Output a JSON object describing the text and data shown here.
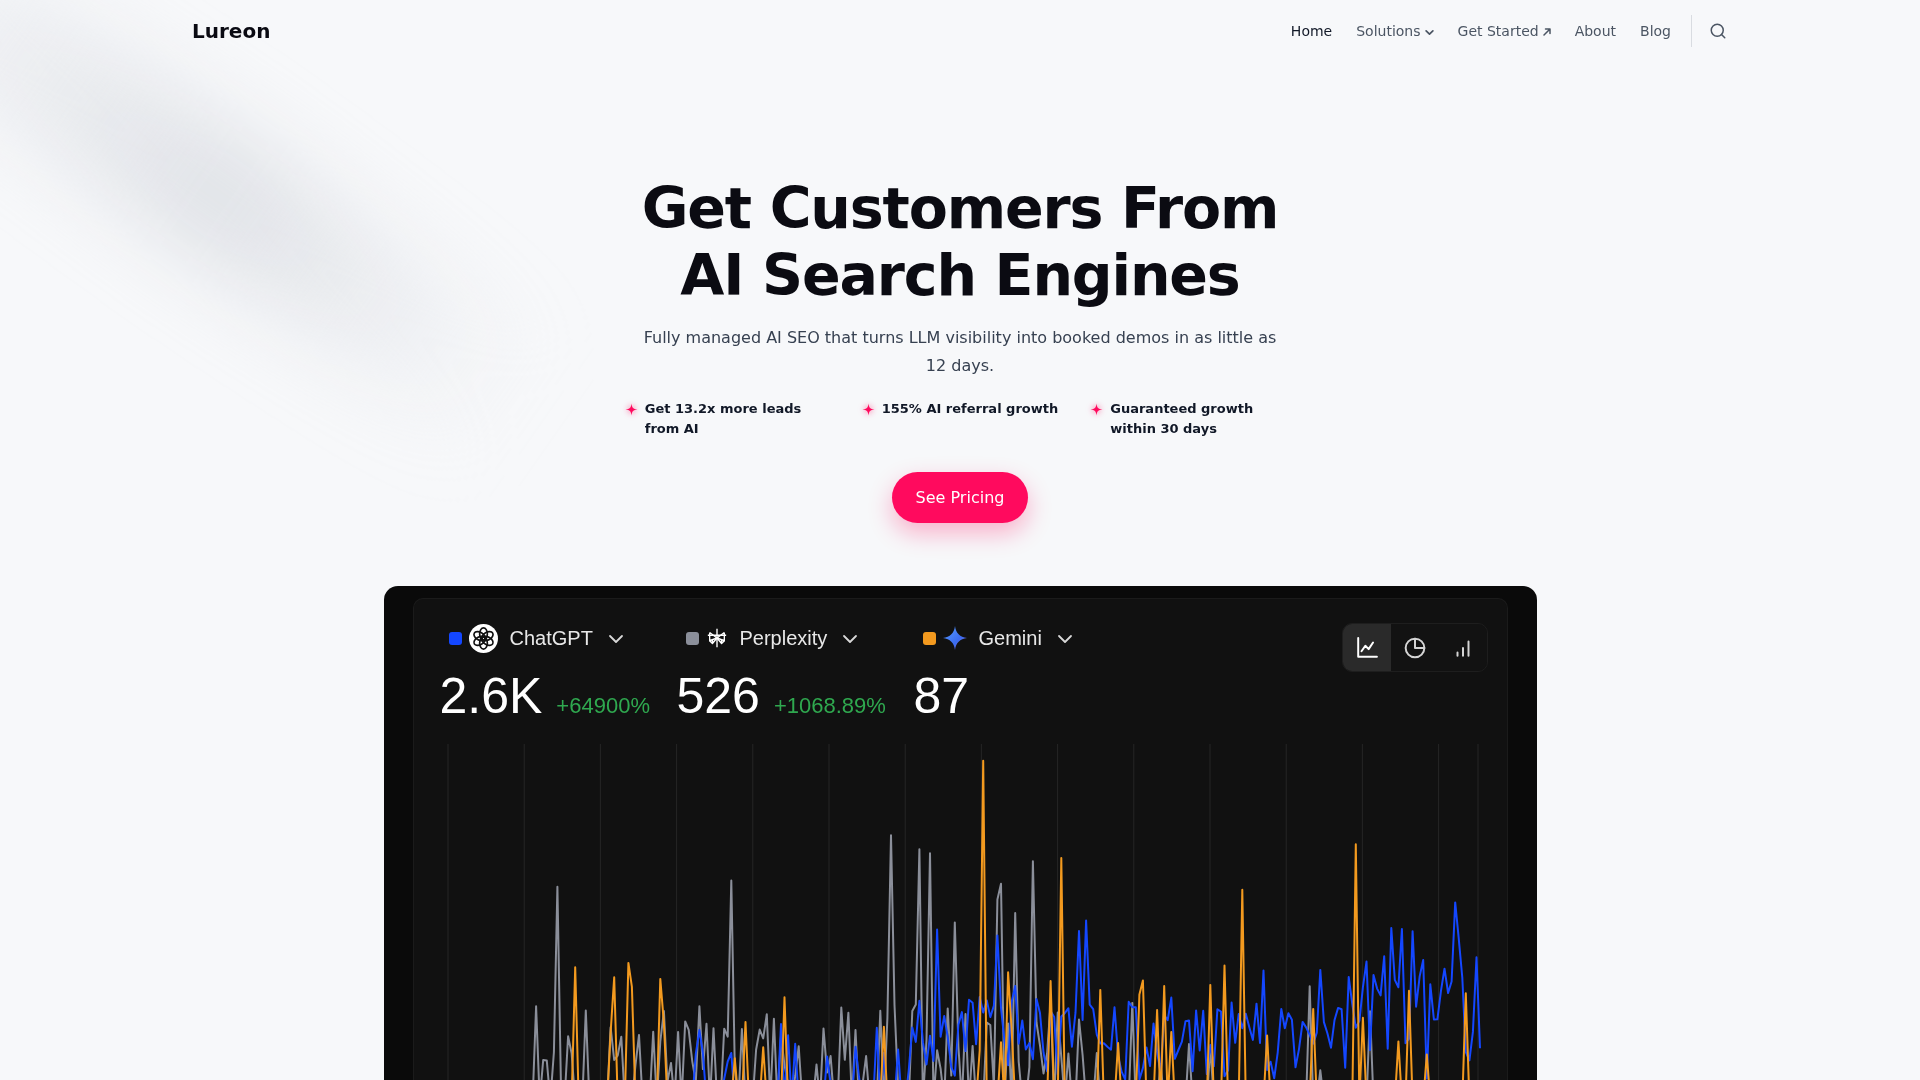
{
  "header": {
    "logo": "Lureon",
    "nav": [
      {
        "label": "Home",
        "kind": "link",
        "selected": true
      },
      {
        "label": "Solutions",
        "kind": "menu",
        "selected": false
      },
      {
        "label": "Get Started",
        "kind": "external",
        "selected": false
      },
      {
        "label": "About",
        "kind": "link",
        "selected": false
      },
      {
        "label": "Blog",
        "kind": "link",
        "selected": false
      }
    ]
  },
  "hero": {
    "title": "Get Customers From AI Search Engines",
    "subtitle": "Fully managed AI SEO that turns LLM visibility into booked demos in as little as 12 days.",
    "highlights": [
      "Get 13.2x more leads from AI",
      "155% AI referral growth",
      "Guaranteed growth within 30 days"
    ],
    "cta": "See Pricing"
  },
  "dashboard": {
    "series": [
      {
        "name": "ChatGPT",
        "color": "#1447ff",
        "value": "2.6K",
        "change": "+64900%"
      },
      {
        "name": "Perplexity",
        "color": "#8b8f9a",
        "value": "526",
        "change": "+1068.89%"
      },
      {
        "name": "Gemini",
        "color": "#f39a1f",
        "value": "87"
      }
    ],
    "view_toggle": [
      {
        "kind": "line",
        "selected": true
      },
      {
        "kind": "pie",
        "selected": false
      },
      {
        "kind": "bar",
        "selected": false
      }
    ]
  }
}
